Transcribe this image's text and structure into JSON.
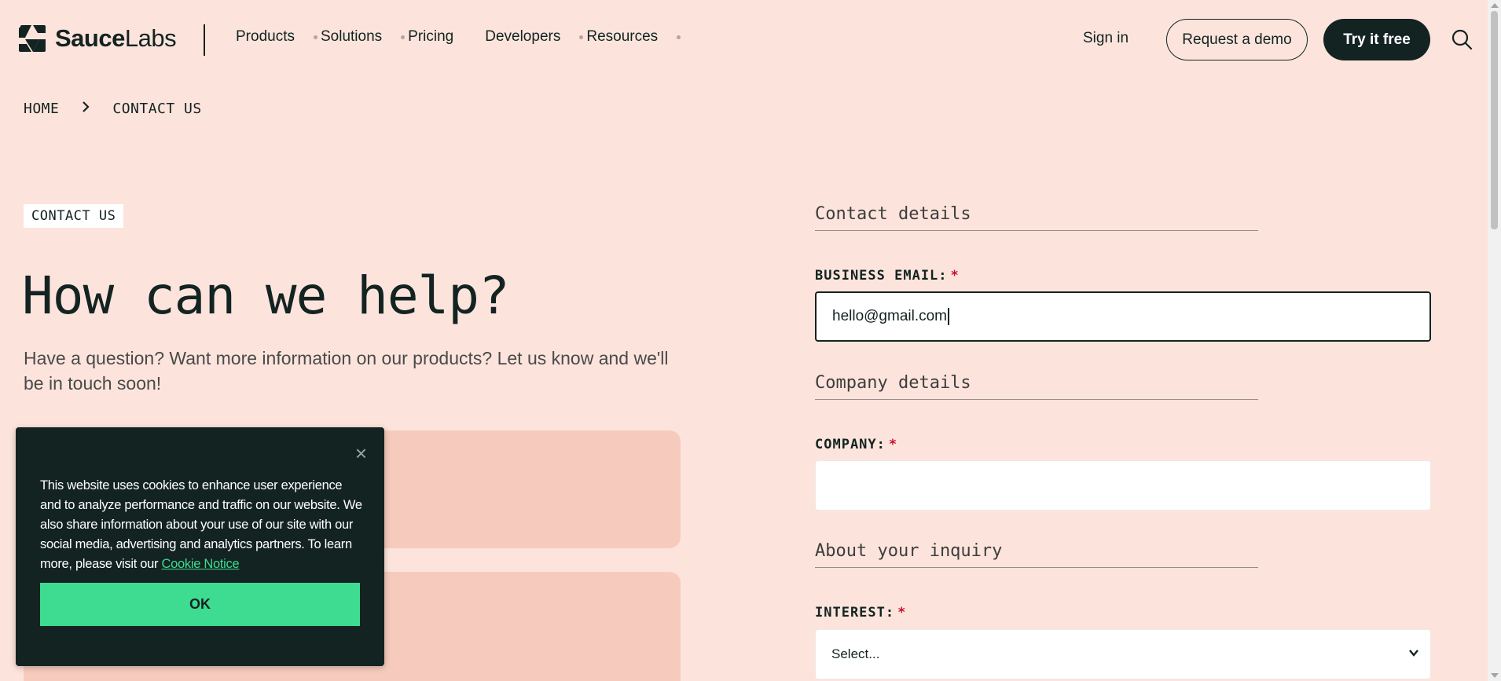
{
  "header": {
    "logo_bold": "Sauce",
    "logo_light": "Labs",
    "nav": [
      "Products",
      "Solutions",
      "Pricing",
      "Developers",
      "Resources"
    ],
    "sign_in": "Sign in",
    "request_demo": "Request a demo",
    "try_free": "Try it free"
  },
  "breadcrumb": {
    "home": "HOME",
    "separator": "›",
    "current": "CONTACT US"
  },
  "hero": {
    "tag": "CONTACT US",
    "title": "How can we help?",
    "subtitle": "Have a question? Want more information on our products? Let us know and we'll be in touch soon!"
  },
  "cookie": {
    "close": "×",
    "text": "This website uses cookies to enhance user experience and to analyze performance and traffic on our website. We also share information about your use of our site with our social media, advertising and analytics partners. To learn more, please visit our",
    "link": "Cookie Notice",
    "ok": "OK"
  },
  "form": {
    "contact_section": "Contact details",
    "email_label": "BUSINESS EMAIL:",
    "email_value": "hello@gmail.com",
    "company_section": "Company details",
    "company_label": "COMPANY:",
    "company_value": "",
    "inquiry_section": "About your inquiry",
    "interest_label": "INTEREST:",
    "interest_value": "Select...",
    "required_mark": "*"
  },
  "colors": {
    "background": "#fce4dc",
    "dark": "#132322",
    "accent_green": "#3ddc91",
    "card": "#f6cbbd",
    "required": "#c8102e"
  }
}
